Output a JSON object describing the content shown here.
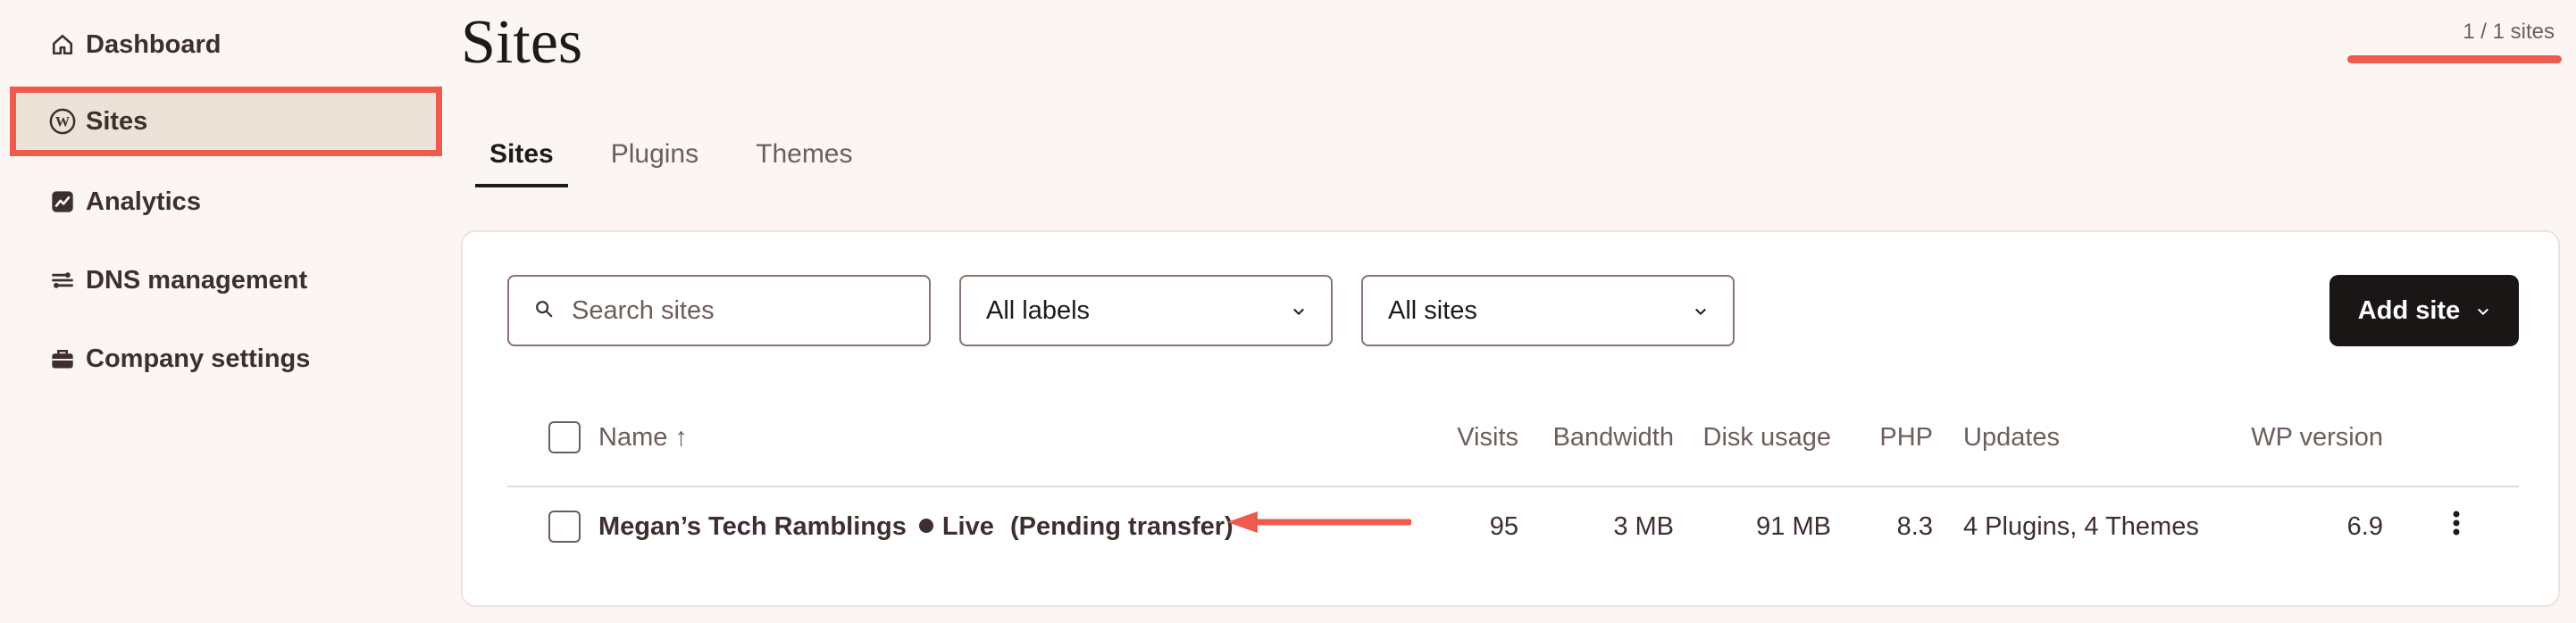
{
  "sidebar": {
    "items": [
      {
        "label": "Dashboard",
        "icon": "home-icon"
      },
      {
        "label": "Sites",
        "icon": "wordpress-icon",
        "active": true
      },
      {
        "label": "Analytics",
        "icon": "chart-icon"
      },
      {
        "label": "DNS management",
        "icon": "dns-icon"
      },
      {
        "label": "Company settings",
        "icon": "briefcase-icon"
      }
    ]
  },
  "header": {
    "title": "Sites",
    "site_count": "1 / 1 sites"
  },
  "tabs": [
    {
      "label": "Sites",
      "active": true
    },
    {
      "label": "Plugins"
    },
    {
      "label": "Themes"
    }
  ],
  "toolbar": {
    "search_placeholder": "Search sites",
    "labels_select": "All labels",
    "sites_select": "All sites",
    "add_site_label": "Add site"
  },
  "table": {
    "columns": [
      "Name ↑",
      "Visits",
      "Bandwidth",
      "Disk usage",
      "PHP",
      "Updates",
      "WP version"
    ],
    "rows": [
      {
        "name": "Megan’s Tech Ramblings",
        "status": "Live",
        "note": "(Pending transfer)",
        "visits": "95",
        "bandwidth": "3 MB",
        "disk_usage": "91 MB",
        "php": "8.3",
        "updates": "4 Plugins, 4 Themes",
        "wp_version": "6.9"
      }
    ]
  },
  "colors": {
    "accent": "#ee5a4c",
    "background": "#fbf6f3",
    "button_dark": "#1a1616"
  }
}
